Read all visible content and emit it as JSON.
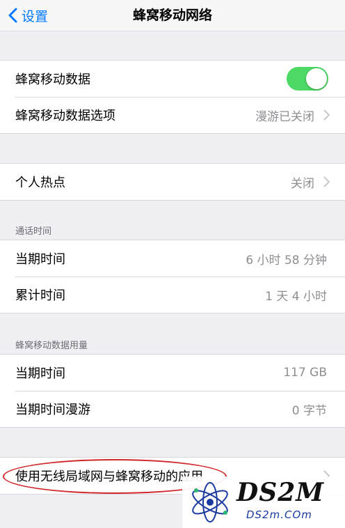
{
  "nav": {
    "back_label": "设置",
    "title": "蜂窝移动网络"
  },
  "group1": {
    "cellular_data": {
      "label": "蜂窝移动数据",
      "toggle_on": true
    },
    "cellular_options": {
      "label": "蜂窝移动数据选项",
      "value": "漫游已关闭"
    }
  },
  "hotspot": {
    "label": "个人热点",
    "value": "关闭"
  },
  "call_time": {
    "header": "通话时间",
    "current": {
      "label": "当期时间",
      "value": "6 小时 58 分钟"
    },
    "lifetime": {
      "label": "累计时间",
      "value": "1 天 4 小时"
    }
  },
  "data_usage": {
    "header": "蜂窝移动数据用量",
    "current": {
      "label": "当期时间",
      "value": "117 GB"
    },
    "roaming": {
      "label": "当期时间漫游",
      "value": "0 字节"
    }
  },
  "wlan_apps": {
    "label": "使用无线局域网与蜂窝移动的应用"
  },
  "watermark": {
    "main": "DS2M",
    "sub": "DS2m.COm"
  },
  "colors": {
    "accent": "#007aff",
    "toggle_on": "#4cd964",
    "annotation": "#d0262a"
  }
}
